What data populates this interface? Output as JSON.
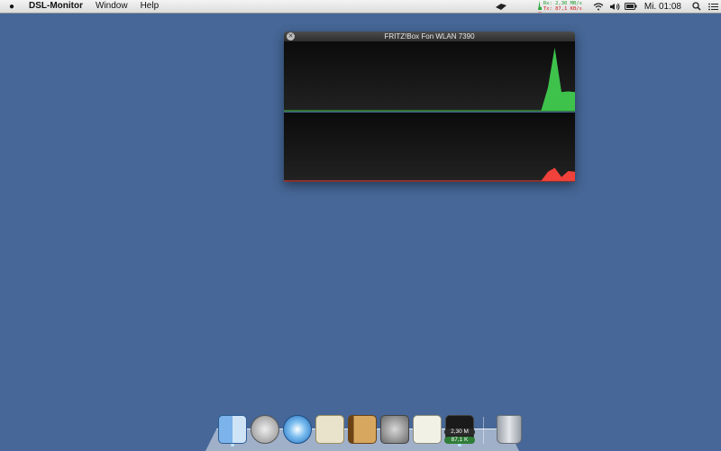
{
  "menubar": {
    "app_name": "DSL-Monitor",
    "menus": [
      "Window",
      "Help"
    ],
    "rates": {
      "rx": "Rx:  2,30 MB/s",
      "tx": "Tx:  87,1 KB/s"
    },
    "clock": "Mi. 01:08"
  },
  "window": {
    "title": "FRITZ!Box Fon WLAN 7390",
    "rx_color": "#3ec24b",
    "tx_color": "#f0413a"
  },
  "dock": {
    "badge_rx": "2,30 M",
    "badge_tx": "87,1 K"
  },
  "chart_data": [
    {
      "type": "area",
      "series": [
        {
          "values": [
            0,
            0,
            0,
            0,
            0,
            0,
            0,
            0,
            0,
            0,
            0,
            0,
            0,
            0,
            0,
            0,
            0,
            0,
            0,
            0,
            0,
            0,
            0,
            0,
            0,
            0,
            0,
            0,
            0,
            0,
            0,
            0,
            0,
            0,
            0,
            0,
            0,
            0,
            0,
            0.35,
            0.95,
            0.28,
            0.29,
            0.28
          ]
        }
      ],
      "ylim": [
        0,
        1
      ]
    },
    {
      "type": "area",
      "series": [
        {
          "values": [
            0,
            0,
            0,
            0,
            0,
            0,
            0,
            0,
            0,
            0,
            0,
            0,
            0,
            0,
            0,
            0,
            0,
            0,
            0,
            0,
            0,
            0,
            0,
            0,
            0,
            0,
            0,
            0,
            0,
            0,
            0,
            0,
            0,
            0,
            0,
            0,
            0,
            0,
            0,
            0.14,
            0.2,
            0.06,
            0.15,
            0.14
          ]
        }
      ],
      "ylim": [
        0,
        1
      ]
    }
  ]
}
